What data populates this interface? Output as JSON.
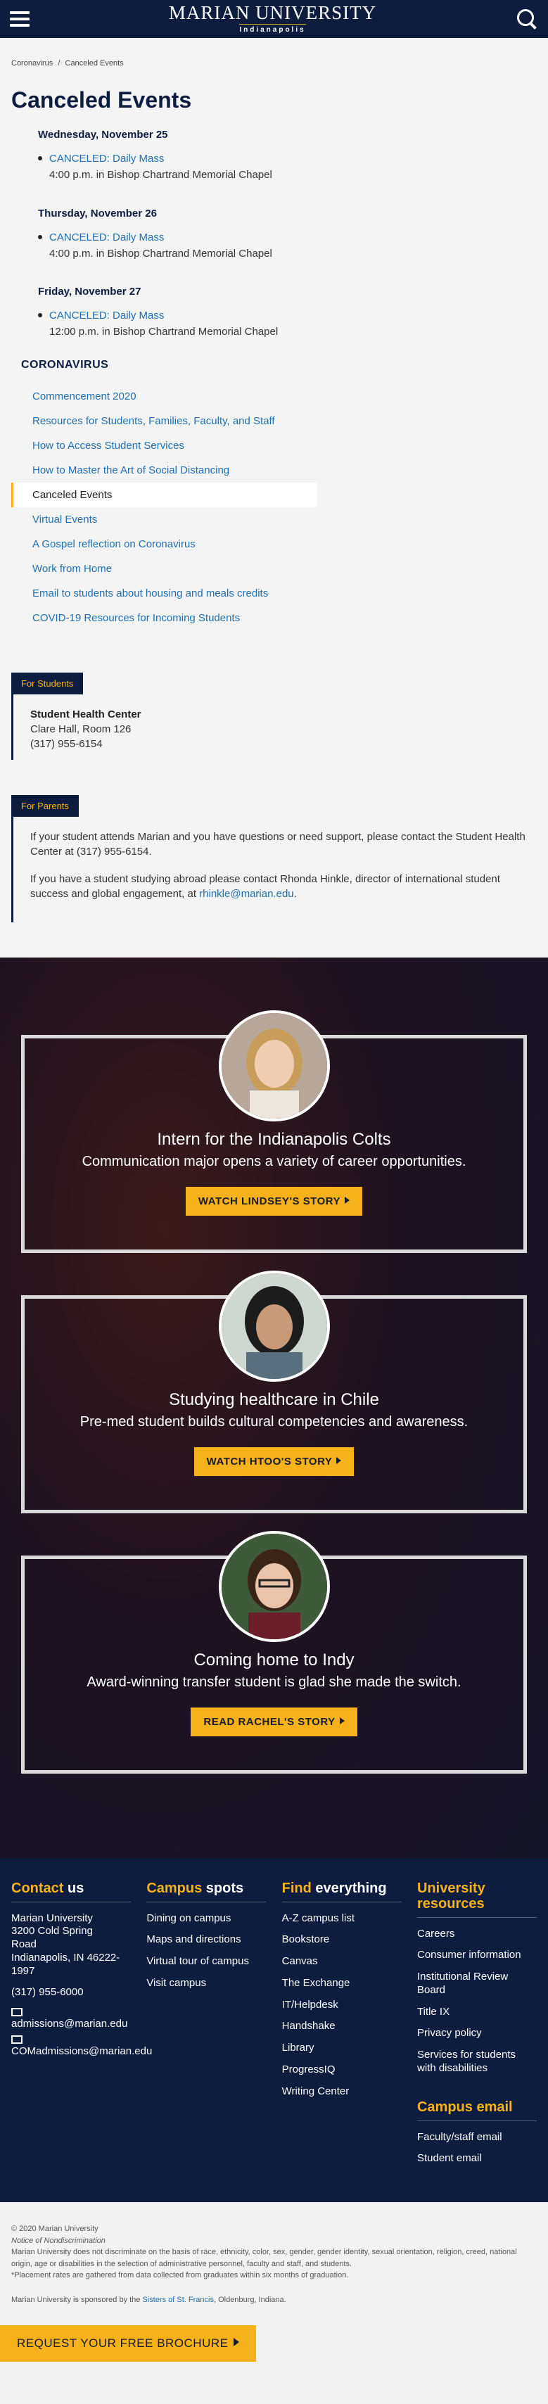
{
  "header": {
    "logo_line1": "MARIAN UNIVERSITY",
    "logo_line2": "Indianapolis",
    "menu_icon": "hamburger-menu-icon",
    "search_icon": "search-icon"
  },
  "breadcrumb": [
    "Coronavirus",
    "/",
    "Canceled Events"
  ],
  "page_title": "Canceled Events",
  "events": [
    {
      "day": "Wednesday, November 25",
      "title": "CANCELED: Daily Mass",
      "detail": "4:00 p.m. in Bishop Chartrand Memorial Chapel"
    },
    {
      "day": "Thursday, November 26",
      "title": "CANCELED: Daily Mass",
      "detail": "4:00 p.m. in Bishop Chartrand Memorial Chapel"
    },
    {
      "day": "Friday, November 27",
      "title": "CANCELED: Daily Mass",
      "detail": "12:00 p.m. in Bishop Chartrand Memorial Chapel"
    }
  ],
  "section_nav": {
    "heading": "CORONAVIRUS",
    "items": [
      "Commencement 2020",
      "Resources for Students, Families, Faculty, and Staff",
      "How to Access Student Services",
      "How to Master the Art of Social Distancing",
      "Canceled Events",
      "Virtual Events",
      "A Gospel reflection on Coronavirus",
      "Work from Home",
      "Email to students about housing and meals credits",
      "COVID-19 Resources for Incoming Students"
    ],
    "active_index": 4
  },
  "for_students": {
    "tag": "For Students",
    "name": "Student Health Center",
    "location": "Clare Hall, Room 126",
    "phone": "(317) 955-6154"
  },
  "for_parents": {
    "tag": "For Parents",
    "p1": "If your student attends Marian and you have questions or need support, please contact the Student Health Center at (317) 955-6154.",
    "p2_prefix": "If you have a student studying abroad please contact Rhonda Hinkle, director of international student success and global engagement, at ",
    "p2_email": "rhinkle@marian.edu",
    "p2_suffix": "."
  },
  "stories": [
    {
      "title": "Intern for the Indianapolis Colts",
      "subtitle": "Communication major opens a variety of career opportunities.",
      "button": "WATCH LINDSEY'S STORY"
    },
    {
      "title": "Studying healthcare in Chile",
      "subtitle": "Pre-med student builds cultural competencies and awareness.",
      "button": "WATCH HTOO'S STORY"
    },
    {
      "title": "Coming home to Indy",
      "subtitle": "Award-winning transfer student is glad she made the switch.",
      "button": "READ RACHEL'S STORY"
    }
  ],
  "footer": {
    "contact": {
      "head_a": "Contact",
      "head_b": " us",
      "address": [
        "Marian University",
        "3200 Cold Spring",
        "Road",
        "Indianapolis, IN 46222-",
        "1997"
      ],
      "phone": "(317) 955-6000",
      "email1": "admissions@marian.edu",
      "email2": "COMadmissions@marian.edu"
    },
    "campus": {
      "head_a": "Campus",
      "head_b": " spots",
      "links": [
        "Dining on campus",
        "Maps and directions",
        "Virtual tour of campus",
        "Visit campus"
      ]
    },
    "find": {
      "head_a": "Find",
      "head_b": " everything",
      "links": [
        "A-Z campus list",
        "Bookstore",
        "Canvas",
        "The Exchange",
        "IT/Helpdesk",
        "Handshake",
        "Library",
        "ProgressIQ",
        "Writing Center"
      ]
    },
    "university": {
      "head_a": "University",
      "head_b": "resources",
      "links": [
        "Careers",
        "Consumer information",
        "Institutional Review Board",
        "Title IX",
        "Privacy policy",
        "Services for students with disabilities"
      ]
    },
    "campus_email": {
      "head_a": "Campus",
      "head_b": " email",
      "links": [
        "Faculty/staff email",
        "Student email"
      ]
    }
  },
  "legal": {
    "copyright": "© 2020 Marian University",
    "notice": "Notice of Nondiscrimination",
    "text": "Marian University does not discriminate on the basis of race, ethnicity, color, sex, gender, gender identity, sexual orientation, religion, creed, national origin, age or disabilities in the selection of administrative personnel, faculty and staff, and students.",
    "placement": "*Placement rates are gathered from data collected from graduates within six months of graduation.",
    "sponsor_prefix": "Marian University is sponsored by the ",
    "sponsor_link": "Sisters of St. Francis",
    "sponsor_suffix": ", Oldenburg, Indiana."
  },
  "brochure_button": "REQUEST YOUR FREE BROCHURE",
  "colors": {
    "navy": "#0d1c3f",
    "gold": "#f5b21b",
    "link": "#1f6fb2"
  }
}
